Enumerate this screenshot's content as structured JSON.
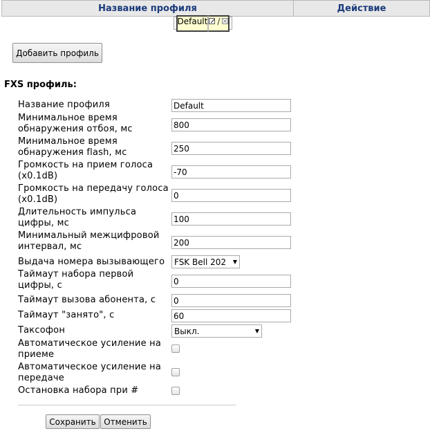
{
  "profiles_table": {
    "columns": [
      "Название профиля",
      "Действие"
    ],
    "rows": [
      {
        "name": "Default",
        "action_separator": "/"
      }
    ]
  },
  "buttons": {
    "add_profile": "Добавить профиль",
    "save": "Сохранить",
    "cancel": "Отменить"
  },
  "fxs": {
    "title": "FXS профиль:",
    "fields": {
      "profile_name": {
        "label": "Название профиля",
        "value": "Default"
      },
      "min_onhook": {
        "label": "Минимальное время обнаружения отбоя, мс",
        "value": "800"
      },
      "min_flash": {
        "label": "Минимальное время обнаружения flash, мс",
        "value": "250"
      },
      "rx_gain": {
        "label": "Громкость на прием голоса (x0.1dB)",
        "value": "-70"
      },
      "tx_gain": {
        "label": "Громкость на передачу голоса (x0.1dB)",
        "value": "0"
      },
      "digit_pulse": {
        "label": "Длительность импульса цифры, мс",
        "value": "100"
      },
      "interdigit": {
        "label": "Минимальный межцифровой интервал, мс",
        "value": "200"
      },
      "caller_id": {
        "label": "Выдача номера вызывающего",
        "value": "FSK Bell 202"
      },
      "first_digit_timeout": {
        "label": "Таймаут набора первой цифры, с",
        "value": "0"
      },
      "call_timeout": {
        "label": "Таймаут вызова абонента, с",
        "value": "0"
      },
      "busy_timeout": {
        "label": "Таймаут \"занято\", с",
        "value": "60"
      },
      "payphone": {
        "label": "Таксофон",
        "value": "Выкл."
      },
      "agc_rx": {
        "label": "Автоматическое усиление на приеме",
        "checked": false
      },
      "agc_tx": {
        "label": "Автоматическое усиление на передаче",
        "checked": false
      },
      "stop_dial_hash": {
        "label": "Остановка набора при #",
        "checked": false
      }
    }
  }
}
